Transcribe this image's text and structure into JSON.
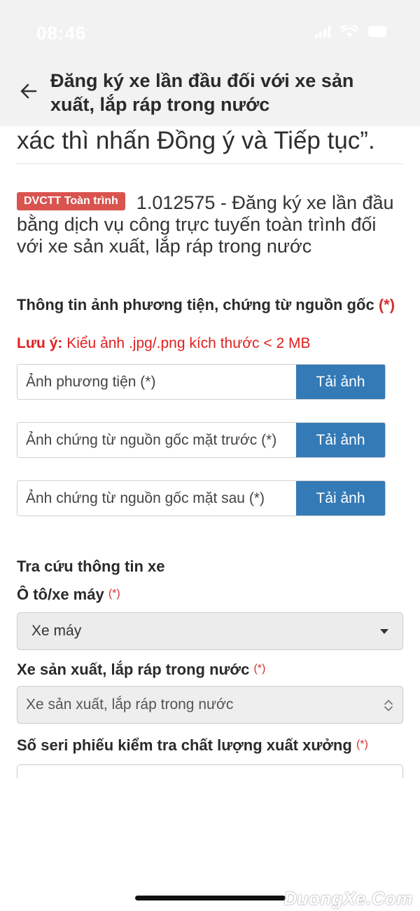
{
  "status": {
    "time": "08:46"
  },
  "header": {
    "title": "Đăng ký xe lần đầu đối với xe sản xuất, lắp ráp trong nước"
  },
  "prev_text": "xác thì nhấn Đồng ý và Tiếp tục”.",
  "procedure": {
    "badge": "DVCTT Toàn trình",
    "text": "1.012575 - Đăng ký xe lần đầu bằng dịch vụ công trực tuyến toàn trình đối với xe sản xuất, lắp ráp trong nước"
  },
  "photo_section": {
    "title": "Thông tin ảnh phương tiện, chứng từ nguồn gốc",
    "required": "(*)",
    "note_label": "Lưu ý:",
    "note_text": " Kiểu ảnh .jpg/.png kích thước < 2 MB",
    "uploads": [
      {
        "label": "Ảnh phương tiện (*)",
        "button": "Tải ảnh"
      },
      {
        "label": "Ảnh chứng từ nguồn gốc mặt trước (*)",
        "button": "Tải ảnh"
      },
      {
        "label": "Ảnh chứng từ nguồn gốc mặt sau (*)",
        "button": "Tải ảnh"
      }
    ]
  },
  "lookup": {
    "title": "Tra cứu thông tin xe",
    "vehicle_type_label": "Ô tô/xe máy",
    "vehicle_type_value": "Xe máy",
    "origin_label": "Xe sản xuất, lắp ráp trong nước",
    "origin_value": "Xe sản xuất, lắp ráp trong nước",
    "serial_label": "Số seri phiếu kiểm tra chất lượng xuất xưởng",
    "required": "(*)"
  },
  "watermark": "DuongXe.Com",
  "colors": {
    "primary": "#337ab7",
    "badge": "#d9534f",
    "required": "#d32f2f",
    "note": "#e02020"
  }
}
